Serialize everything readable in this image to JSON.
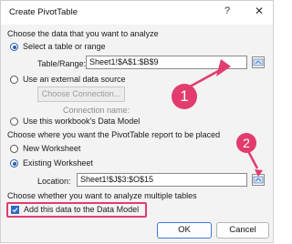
{
  "dialog": {
    "title": "Create PivotTable",
    "help_glyph": "?",
    "close_glyph": "✕"
  },
  "section1": {
    "heading": "Choose the data that you want to analyze",
    "option_table_range": "Select a table or range",
    "table_range_label": "Table/Range:",
    "table_range_value": "Sheet1!$A$1:$B$9",
    "option_external": "Use an external data source",
    "choose_connection_label": "Choose Connection...",
    "connection_name_label": "Connection name:",
    "option_data_model": "Use this workbook's Data Model"
  },
  "section2": {
    "heading": "Choose where you want the PivotTable report to be placed",
    "option_new_worksheet": "New Worksheet",
    "option_existing_worksheet": "Existing Worksheet",
    "location_label": "Location:",
    "location_value": "Sheet1!$J$3:$O$15"
  },
  "section3": {
    "heading": "Choose whether you want to analyze multiple tables",
    "checkbox_label": "Add this data to the Data Model",
    "checkbox_checked": true
  },
  "buttons": {
    "ok_label": "OK",
    "cancel_label": "Cancel"
  },
  "annotations": {
    "badge1": "1",
    "badge2": "2",
    "accent_color": "#e23c6f"
  },
  "icons": {
    "collapse_dialog": "collapse-dialog-icon"
  }
}
